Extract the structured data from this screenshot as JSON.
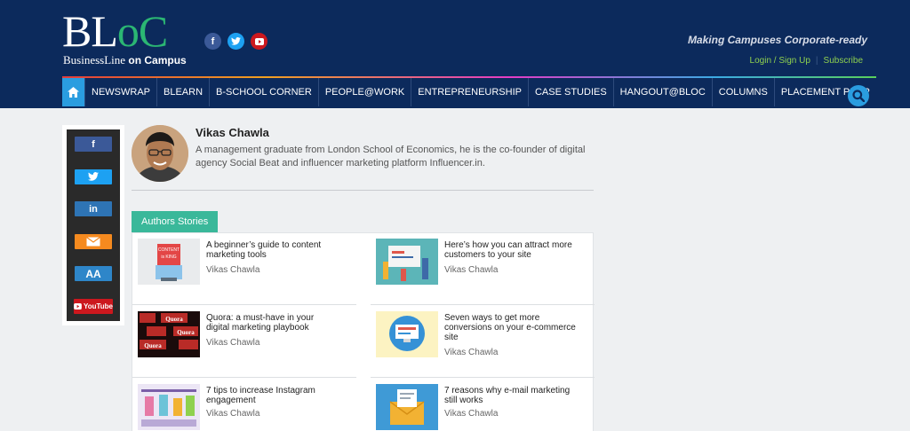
{
  "header": {
    "logo_main_a": "BL",
    "logo_main_b": "oC",
    "logo_sub_a": "BusinessLine",
    "logo_sub_b": " on Campus",
    "tagline": "Making Campuses Corporate-ready",
    "login_link": "Login / Sign Up",
    "link_sep": "|",
    "subscribe_link": "Subscribe"
  },
  "nav": {
    "items": [
      "NEWSWRAP",
      "BLEARN",
      "B-SCHOOL CORNER",
      "PEOPLE@WORK",
      "ENTREPRENEURSHIP",
      "CASE STUDIES",
      "HANGOUT@BLOC",
      "COLUMNS",
      "PLACEMENT PREP"
    ]
  },
  "share": {
    "facebook": "f",
    "twitter": "🐦",
    "linkedin": "in",
    "font_size": "AA",
    "youtube": "YouTube"
  },
  "author": {
    "name": "Vikas Chawla",
    "bio": "A management graduate from London School of Economics, he is the co-founder of digital agency Social Beat and influencer marketing platform Influencer.in."
  },
  "stories_tab": "Authors Stories",
  "stories": [
    {
      "title": "A beginner’s guide to content marketing tools",
      "author": "Vikas Chawla"
    },
    {
      "title": "Here’s how you can attract more customers to your site",
      "author": "Vikas Chawla"
    },
    {
      "title": "Quora: a must-have in your digital marketing playbook",
      "author": "Vikas Chawla"
    },
    {
      "title": "Seven ways to get more conversions on your e-commerce site",
      "author": "Vikas Chawla"
    },
    {
      "title": "7 tips to increase Instagram engagement",
      "author": "Vikas Chawla"
    },
    {
      "title": "7 reasons why e-mail marketing still works",
      "author": "Vikas Chawla"
    }
  ],
  "thumb_text": {
    "content_king_a": "CONTENT",
    "content_king_b": "is KING",
    "quora": "Quora"
  },
  "colors": {
    "header_bg": "#0c2a5c",
    "accent_blue": "#2a9de0",
    "tab_green": "#3ab89a",
    "link_green": "#8fd14f"
  }
}
